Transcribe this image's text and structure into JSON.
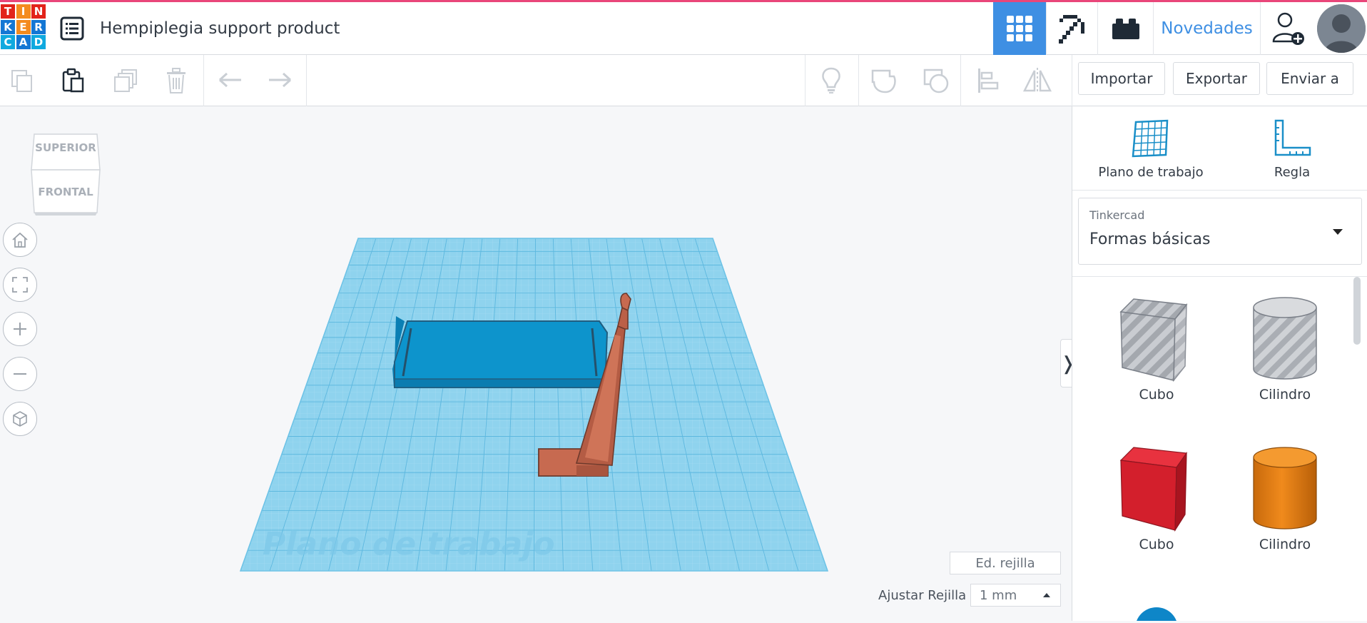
{
  "app": {
    "logo_letters": [
      "T",
      "I",
      "N",
      "K",
      "E",
      "R",
      "C",
      "A",
      "D"
    ],
    "logo_colors": [
      "#e2231a",
      "#f48b1f",
      "#e2231a",
      "#1477d4",
      "#f48b1f",
      "#1477d4",
      "#0fa9df",
      "#1477d4",
      "#0fa9df"
    ],
    "project_title": "Hempiplegia support product",
    "accent_color": "#3e8fe3"
  },
  "header": {
    "news_label": "Novedades",
    "icons": [
      "3d-design-grid-icon",
      "pickaxe-icon",
      "bricks-icon",
      "add-user-icon"
    ]
  },
  "toolbar": {
    "left_icons": [
      "copy-icon",
      "paste-icon",
      "duplicate-icon",
      "delete-icon",
      "undo-icon",
      "redo-icon"
    ],
    "right_icons": [
      "lightbulb-icon",
      "shape-solid-icon",
      "shape-hole-icon",
      "align-icon",
      "mirror-icon"
    ],
    "import_label": "Importar",
    "export_label": "Exportar",
    "send_label": "Enviar a"
  },
  "viewcube": {
    "top_label": "SUPERIOR",
    "front_label": "FRONTAL"
  },
  "nav_controls": [
    "home-icon",
    "fit-view-icon",
    "zoom-in-icon",
    "zoom-out-icon",
    "perspective-icon"
  ],
  "workplane": {
    "label": "Plano de trabajo",
    "edit_grid_label": "Ed. rejilla",
    "snap_label": "Ajustar Rejilla",
    "snap_value": "1 mm",
    "plane_color": "#8fd3ee",
    "objects": [
      {
        "name": "blue-platform",
        "color": "#0e96cf"
      },
      {
        "name": "orange-support",
        "color": "#c9694f"
      }
    ]
  },
  "panel": {
    "workplane_tool": "Plano de trabajo",
    "ruler_tool": "Regla",
    "library_category": "Tinkercad",
    "library_value": "Formas básicas",
    "shapes": [
      {
        "label": "Cubo",
        "kind": "box-hole"
      },
      {
        "label": "Cilindro",
        "kind": "cylinder-hole"
      },
      {
        "label": "Cubo",
        "kind": "box-red"
      },
      {
        "label": "Cilindro",
        "kind": "cylinder-orange"
      }
    ]
  }
}
